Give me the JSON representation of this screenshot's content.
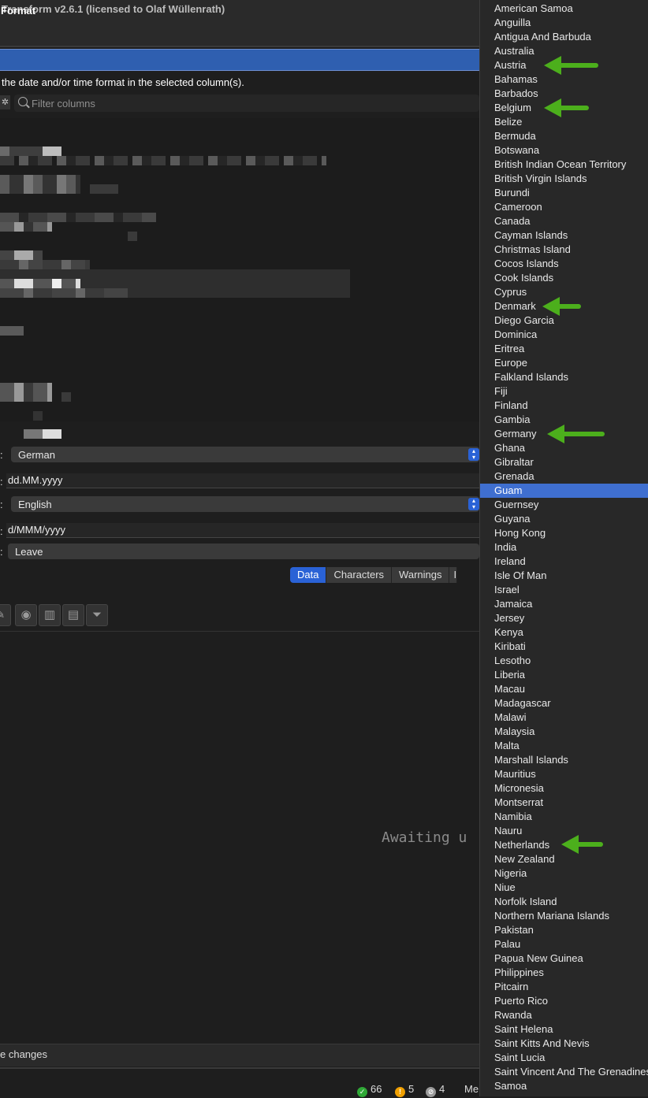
{
  "window": {
    "title": "Transform v2.6.1 (licensed to Olaf Wüllenrath)"
  },
  "section": {
    "label": "Format"
  },
  "description": "the date and/or time format in the selected column(s).",
  "filter": {
    "placeholder": "Filter columns"
  },
  "form": {
    "input_locale": "German",
    "input_format": "dd.MM.yyyy",
    "output_locale": "English",
    "output_format": "d/MMM/yyyy",
    "unparseable_action": "Leave"
  },
  "tabs": [
    "Data",
    "Characters",
    "Warnings",
    "I"
  ],
  "awaiting_text": "Awaiting u",
  "footer": {
    "changes": "e changes"
  },
  "status": {
    "ok": "66",
    "warn": "5",
    "blocked": "4",
    "more": "Me"
  },
  "colors": {
    "accent": "#2a62d6",
    "selection": "#3f6fd0",
    "arrow": "#4caf1c"
  },
  "dropdown": {
    "selected": "Guam",
    "items": [
      "American Samoa",
      "Anguilla",
      "Antigua And Barbuda",
      "Australia",
      "Austria",
      "Bahamas",
      "Barbados",
      "Belgium",
      "Belize",
      "Bermuda",
      "Botswana",
      "British Indian Ocean Territory",
      "British Virgin Islands",
      "Burundi",
      "Cameroon",
      "Canada",
      "Cayman Islands",
      "Christmas Island",
      "Cocos Islands",
      "Cook Islands",
      "Cyprus",
      "Denmark",
      "Diego Garcia",
      "Dominica",
      "Eritrea",
      "Europe",
      "Falkland Islands",
      "Fiji",
      "Finland",
      "Gambia",
      "Germany",
      "Ghana",
      "Gibraltar",
      "Grenada",
      "Guam",
      "Guernsey",
      "Guyana",
      "Hong Kong",
      "India",
      "Ireland",
      "Isle Of Man",
      "Israel",
      "Jamaica",
      "Jersey",
      "Kenya",
      "Kiribati",
      "Lesotho",
      "Liberia",
      "Macau",
      "Madagascar",
      "Malawi",
      "Malaysia",
      "Malta",
      "Marshall Islands",
      "Mauritius",
      "Micronesia",
      "Montserrat",
      "Namibia",
      "Nauru",
      "Netherlands",
      "New Zealand",
      "Nigeria",
      "Niue",
      "Norfolk Island",
      "Northern Mariana Islands",
      "Pakistan",
      "Palau",
      "Papua New Guinea",
      "Philippines",
      "Pitcairn",
      "Puerto Rico",
      "Rwanda",
      "Saint Helena",
      "Saint Kitts And Nevis",
      "Saint Lucia",
      "Saint Vincent And The Grenadines",
      "Samoa"
    ],
    "highlighted": [
      "Austria",
      "Belgium",
      "Denmark",
      "Germany",
      "Netherlands"
    ]
  }
}
